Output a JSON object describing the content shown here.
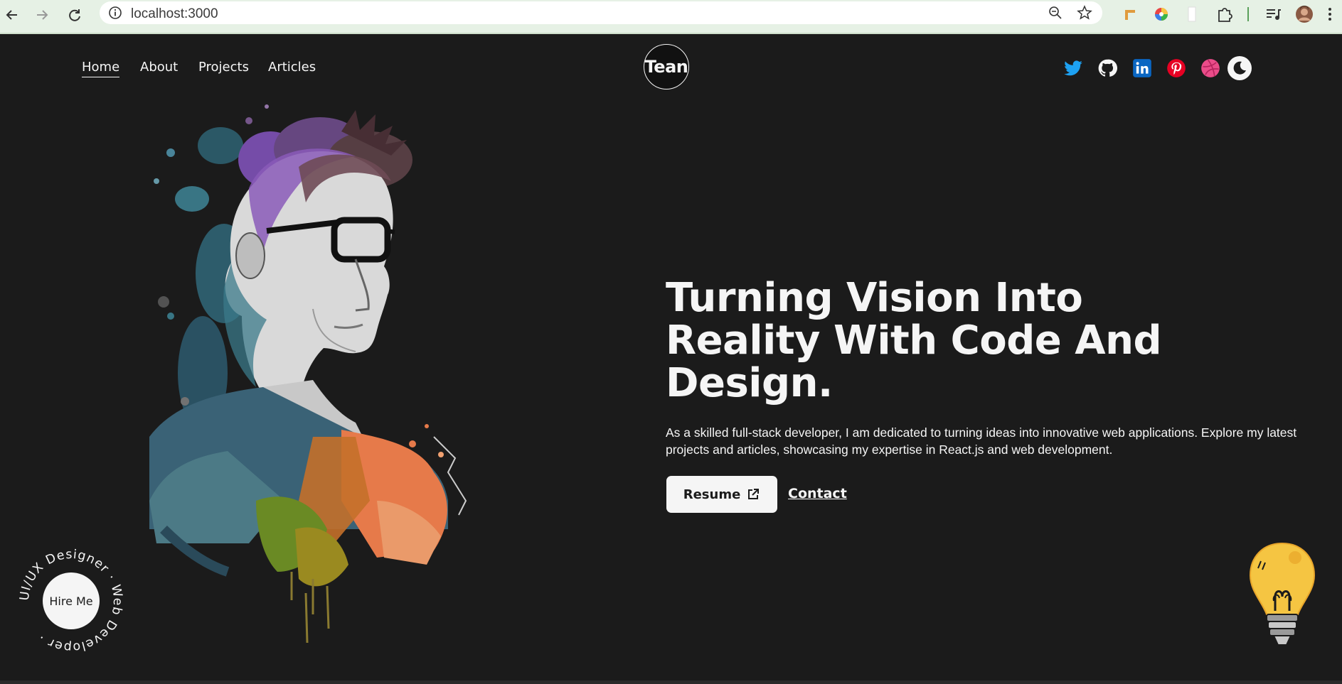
{
  "browser": {
    "url": "localhost:3000"
  },
  "nav": {
    "links": [
      "Home",
      "About",
      "Projects",
      "Articles"
    ],
    "logo_text": "Tean",
    "socials": [
      "twitter-icon",
      "github-icon",
      "linkedin-icon",
      "pinterest-icon",
      "dribbble-icon"
    ],
    "theme_toggle_icon": "moon-icon"
  },
  "hero": {
    "title": "Turning Vision Into Reality With Code And Design.",
    "description": "As a skilled full-stack developer, I am dedicated to turning ideas into innovative web applications. Explore my latest projects and articles, showcasing my expertise in React.js and web development.",
    "resume_label": "Resume",
    "contact_label": "Contact"
  },
  "hire": {
    "button_label": "Hire Me",
    "ring_text": "UI/UX Designer · Web Developer ·"
  },
  "colors": {
    "background": "#1b1b1b",
    "foreground": "#f5f5f5",
    "twitter": "#1DA1F2",
    "linkedin": "#0A66C2",
    "pinterest": "#E60023",
    "dribbble": "#EA4C89"
  }
}
